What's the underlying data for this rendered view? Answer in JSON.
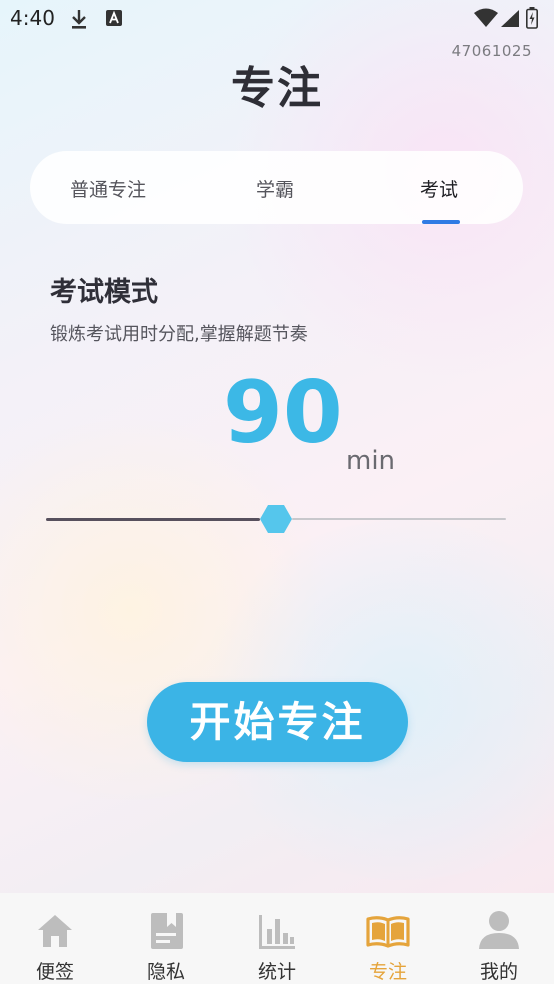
{
  "status_bar": {
    "time": "4:40"
  },
  "device_id": "47061025",
  "page": {
    "title": "专注"
  },
  "tabs": [
    {
      "label": "普通专注"
    },
    {
      "label": "学霸"
    },
    {
      "label": "考试"
    }
  ],
  "active_tab": "考试",
  "mode": {
    "title": "考试模式",
    "description": "锻炼考试用时分配,掌握解题节奏"
  },
  "timer": {
    "value": "90",
    "unit": "min",
    "slider_fraction": 0.5
  },
  "start_button": {
    "label": "开始专注"
  },
  "bottom_nav": [
    {
      "label": "便签",
      "icon": "home-icon"
    },
    {
      "label": "隐私",
      "icon": "notebook-icon"
    },
    {
      "label": "统计",
      "icon": "bar-chart-icon"
    },
    {
      "label": "专注",
      "icon": "open-book-icon"
    },
    {
      "label": "我的",
      "icon": "user-icon"
    }
  ],
  "active_nav": "专注",
  "colors": {
    "accent": "#3bb4e6",
    "tab_indicator": "#2f7be4",
    "nav_active": "#e5a43b",
    "nav_inactive": "#bdbdbd"
  }
}
